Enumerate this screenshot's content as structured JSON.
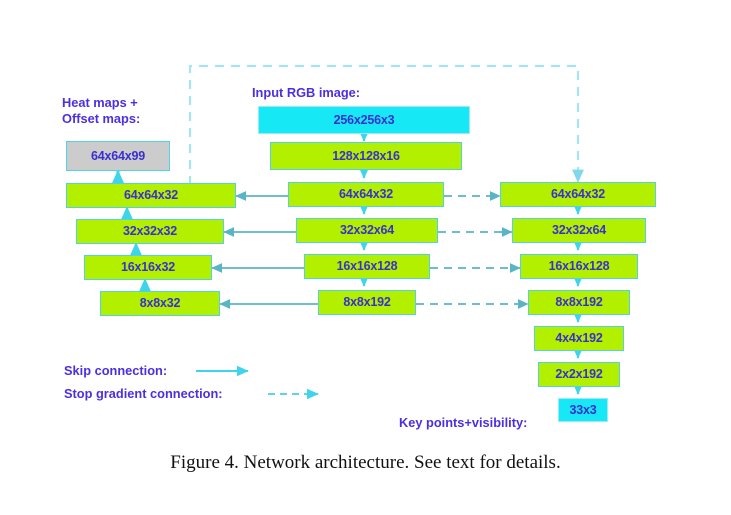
{
  "figure": {
    "caption": "Figure 4. Network architecture. See text for details.",
    "colors": {
      "green_block": "#b2f000",
      "cyan_block": "#16e9f5",
      "gray_block": "#cccccc",
      "border": "#4fd3e8",
      "text_blue": "#3a2fd0",
      "label_purple": "#4b2fe0",
      "arrow_cyan": "#3fd4ec",
      "arrow_steel": "#5ab4c8",
      "dashed_light": "#a8e4f0",
      "background": "#ffffff"
    }
  },
  "labels": {
    "heat_maps": "Heat maps +\nOffset maps:",
    "input_image": "Input RGB image:",
    "key_points": "Key points+visibility:",
    "legend_skip": "Skip connection:",
    "legend_stop_gradient": "Stop gradient connection:"
  },
  "columns": {
    "output_head": {
      "name": "heat-offset-map-head",
      "nodes": [
        {
          "id": "heat-offset-map",
          "label": "64x64x99",
          "style": "gray"
        }
      ]
    },
    "left": {
      "name": "decoder-left-column",
      "nodes": [
        {
          "id": "left-64",
          "label": "64x64x32",
          "style": "green"
        },
        {
          "id": "left-32",
          "label": "32x32x32",
          "style": "green"
        },
        {
          "id": "left-16",
          "label": "16x16x32",
          "style": "green"
        },
        {
          "id": "left-8",
          "label": "8x8x32",
          "style": "green"
        }
      ]
    },
    "center": {
      "name": "encoder-center-column",
      "nodes": [
        {
          "id": "center-input",
          "label": "256x256x3",
          "style": "cyan"
        },
        {
          "id": "center-128",
          "label": "128x128x16",
          "style": "green"
        },
        {
          "id": "center-64",
          "label": "64x64x32",
          "style": "green"
        },
        {
          "id": "center-32",
          "label": "32x32x64",
          "style": "green"
        },
        {
          "id": "center-16",
          "label": "16x16x128",
          "style": "green"
        },
        {
          "id": "center-8",
          "label": "8x8x192",
          "style": "green"
        }
      ]
    },
    "right": {
      "name": "classifier-right-column",
      "nodes": [
        {
          "id": "right-64",
          "label": "64x64x32",
          "style": "green"
        },
        {
          "id": "right-32",
          "label": "32x32x64",
          "style": "green"
        },
        {
          "id": "right-16",
          "label": "16x16x128",
          "style": "green"
        },
        {
          "id": "right-8",
          "label": "8x8x192",
          "style": "green"
        },
        {
          "id": "right-4",
          "label": "4x4x192",
          "style": "green"
        },
        {
          "id": "right-2",
          "label": "2x2x192",
          "style": "green"
        },
        {
          "id": "right-out",
          "label": "33x3",
          "style": "cyan"
        }
      ]
    }
  },
  "connections": {
    "skip": [
      {
        "from": "center-64",
        "to": "left-64",
        "type": "solid"
      },
      {
        "from": "center-32",
        "to": "left-32",
        "type": "solid"
      },
      {
        "from": "center-16",
        "to": "left-16",
        "type": "solid"
      },
      {
        "from": "center-8",
        "to": "left-8",
        "type": "solid"
      }
    ],
    "stop_gradient": [
      {
        "from": "center-input",
        "to": "right-64",
        "type": "dashed"
      },
      {
        "from": "center-64",
        "to": "right-64",
        "type": "dashed"
      },
      {
        "from": "center-32",
        "to": "right-32",
        "type": "dashed"
      },
      {
        "from": "center-16",
        "to": "right-16",
        "type": "dashed"
      },
      {
        "from": "center-8",
        "to": "right-8",
        "type": "dashed"
      }
    ]
  }
}
